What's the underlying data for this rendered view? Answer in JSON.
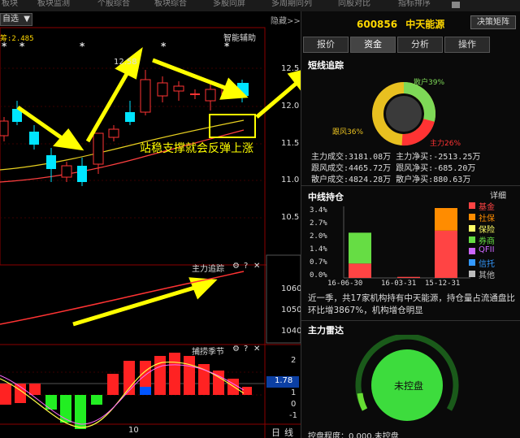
{
  "topbar": {
    "items": [
      "板块",
      "板块监测",
      "个股综合",
      "板块综合",
      "多股同屏",
      "多周期同列",
      "同股对比",
      "指标排序"
    ]
  },
  "left": {
    "ma_select": "自选",
    "ma_value_label": "筹:2.485",
    "hide_label": "隐藏>>",
    "smart_assist": "智能辅助",
    "high_price_label": "12.58",
    "annotation_text": "站稳支撑就会反弹上涨",
    "price_axis": [
      "12.5",
      "12.0",
      "11.5",
      "11.0",
      "10.5"
    ],
    "sub1": {
      "title": "主力追踪",
      "axis": [
        "1060",
        "1050",
        "1040"
      ]
    },
    "sub2": {
      "title": "捕捞季节",
      "axis": [
        "2",
        "1",
        "0",
        "-1"
      ],
      "current": "1.78"
    },
    "date_label": "10",
    "period_labels": [
      "日",
      "线"
    ]
  },
  "right": {
    "stock_code": "600856",
    "stock_name": "中天能源",
    "decision_button": "决策矩阵",
    "tabs": [
      "报价",
      "资金",
      "分析",
      "操作"
    ],
    "active_tab": "资金",
    "short_track": {
      "title": "短线追踪",
      "segments": [
        {
          "name": "散户",
          "pct": "39%",
          "color": "#7ed957"
        },
        {
          "name": "主力",
          "pct": "26%",
          "color": "#ff3333"
        },
        {
          "name": "跟风",
          "pct": "36%",
          "color": "#e8c020"
        }
      ],
      "rows": [
        [
          "主力成交:3181.08万",
          "主力净买:-2513.25万"
        ],
        [
          "跟风成交:4465.72万",
          "跟风净买:-685.20万"
        ],
        [
          "散户成交:4824.28万",
          "散户净买:880.63万"
        ]
      ]
    },
    "mid_hold": {
      "title": "中线持仓",
      "detail": "详细",
      "y_axis": [
        "3.4%",
        "2.7%",
        "2.0%",
        "1.4%",
        "0.7%",
        "0.0%"
      ],
      "x_axis": [
        "16-06-30",
        "16-03-31",
        "15-12-31"
      ],
      "legend": [
        {
          "name": "基金",
          "color": "#ff4444"
        },
        {
          "name": "社保",
          "color": "#ff8c00"
        },
        {
          "name": "保险",
          "color": "#ffff66"
        },
        {
          "name": "券商",
          "color": "#66dd44"
        },
        {
          "name": "QFII",
          "color": "#cc66ff"
        },
        {
          "name": "信托",
          "color": "#3399ff"
        },
        {
          "name": "其他",
          "color": "#bbbbbb"
        }
      ],
      "text": "近一季，共17家机构持有中天能源，持仓量占流通盘比环比增3867%，机构增仓明显"
    },
    "radar": {
      "title": "主力雷达",
      "status": "未控盘",
      "footer": "控盘程度：0.000,未控盘"
    }
  },
  "chart_data": [
    {
      "type": "bar",
      "title": "中线持仓",
      "categories": [
        "16-06-30",
        "16-03-31",
        "15-12-31"
      ],
      "series": [
        {
          "name": "基金",
          "values": [
            0.7,
            0.05,
            2.3
          ]
        },
        {
          "name": "社保",
          "values": [
            0.0,
            0.0,
            1.1
          ]
        },
        {
          "name": "券商",
          "values": [
            1.5,
            0.0,
            0.0
          ]
        }
      ],
      "ylim": [
        0,
        3.4
      ]
    },
    {
      "type": "pie",
      "title": "短线追踪",
      "categories": [
        "散户",
        "主力",
        "跟风"
      ],
      "values": [
        39,
        26,
        36
      ]
    }
  ]
}
